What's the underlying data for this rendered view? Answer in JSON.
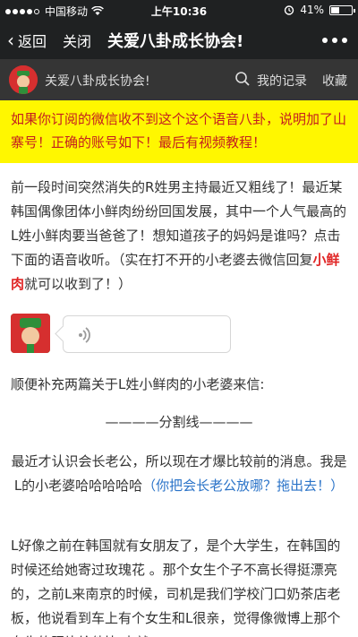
{
  "status_bar": {
    "carrier": "中国移动",
    "time": "上午10:36",
    "battery": "41%",
    "battery_level": 0.41,
    "signal_bars_filled": 4
  },
  "navbar": {
    "back_label": "返回",
    "close_label": "关闭",
    "title": "关爱八卦成长协会!"
  },
  "account": {
    "name": "关爱八卦成长协会!",
    "records_label": "我的记录",
    "favorites_label": "收藏"
  },
  "notice": {
    "text": "如果你订阅的微信收不到这个这个语音八卦，说明加了山寨号！正确的账号如下！最后有视频教程！"
  },
  "article": {
    "p1_a": "前一段时间突然消失的R姓男主持最近又粗线了！最近某韩国偶像团体小鲜肉纷纷回国发展，其中一个人气最高的L姓小鲜肉要当爸爸了！想知道孩子的妈妈是谁吗？点击下面的语音收听。（实在打不开的小老婆去微信回复",
    "p1_highlight": "小鲜肉",
    "p1_b": "就可以收到了！）",
    "p2": "顺便补充两篇关于L姓小鲜肉的小老婆来信:",
    "divider": "————分割线————",
    "p3_a": "最近才认识会长老公，所以现在才爆比较前的消息。我是L的小老婆哈哈哈哈哈",
    "p3_link": "（你把会长老公放哪？拖出去！）",
    "p4": "L好像之前在韩国就有女朋友了，是个大学生，在韩国的时候还给她寄过玫瑰花 。那个女生个子不高长得挺漂亮的，之前L来南京的时候，司机是我们学校门口奶茶店老板，他说看到车上有个女生和L很亲，觉得像微博上那个女生的照片给他比对 就"
  },
  "colors": {
    "bar_dark": "#1f2122",
    "account_bar": "#353535",
    "notice_bg": "#fff700",
    "notice_text": "#c41f1f",
    "highlight_red": "#e02424",
    "link_blue": "#2a73c8"
  }
}
